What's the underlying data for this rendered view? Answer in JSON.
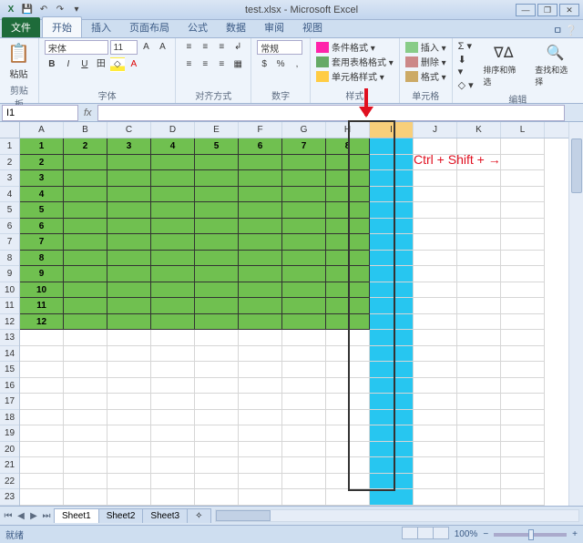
{
  "window": {
    "title": "test.xlsx - Microsoft Excel"
  },
  "qat": {
    "excel": "X",
    "save": "💾",
    "undo": "↶",
    "redo": "↷",
    "more": "▾"
  },
  "tabs": {
    "file": "文件",
    "items": [
      "开始",
      "插入",
      "页面布局",
      "公式",
      "数据",
      "审阅",
      "视图"
    ],
    "active": 0,
    "help": "ㅁ ❔"
  },
  "ribbon": {
    "clipboard": {
      "label": "剪贴板",
      "paste": "粘贴",
      "paste_icon": "📋"
    },
    "font": {
      "label": "字体",
      "name": "宋体",
      "size": "11",
      "bold": "B",
      "italic": "I",
      "underline": "U"
    },
    "align": {
      "label": "对齐方式"
    },
    "number": {
      "label": "数字",
      "fmt": "常规"
    },
    "styles": {
      "label": "样式",
      "cond": "条件格式 ▾",
      "tbl": "套用表格格式 ▾",
      "cell": "单元格样式 ▾"
    },
    "cells": {
      "label": "单元格",
      "insert": "插入 ▾",
      "delete": "删除 ▾",
      "format": "格式 ▾"
    },
    "editing": {
      "label": "编辑",
      "sort": "排序和筛选",
      "find": "查找和选择"
    }
  },
  "namebox": {
    "ref": "I1",
    "fx": "fx"
  },
  "columns": [
    "A",
    "B",
    "C",
    "D",
    "E",
    "F",
    "G",
    "H",
    "I",
    "J",
    "K",
    "L"
  ],
  "selected_col": "I",
  "rows": 23,
  "green_rows": 12,
  "green_cols": 8,
  "header_vals": [
    "1",
    "2",
    "3",
    "4",
    "5",
    "6",
    "7",
    "8"
  ],
  "colA_vals": [
    "1",
    "2",
    "3",
    "4",
    "5",
    "6",
    "7",
    "8",
    "9",
    "10",
    "11",
    "12"
  ],
  "sheets": {
    "active": "Sheet1",
    "others": [
      "Sheet2",
      "Sheet3"
    ],
    "new": "✧"
  },
  "status": {
    "ready": "就绪",
    "zoom": "100%",
    "minus": "−",
    "plus": "+"
  },
  "annotation": {
    "text": "Ctrl + Shift + →"
  }
}
